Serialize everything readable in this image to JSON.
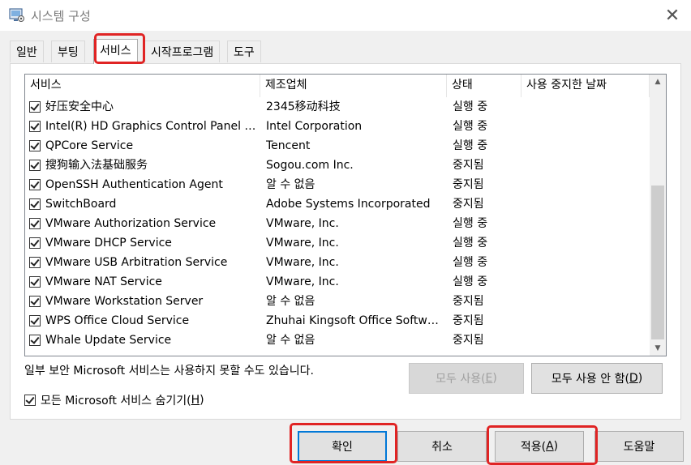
{
  "window": {
    "title": "시스템 구성",
    "icon": "system-config-icon",
    "close_glyph": "✕"
  },
  "tabs": [
    {
      "label": "일반",
      "active": false
    },
    {
      "label": "부팅",
      "active": false
    },
    {
      "label": "서비스",
      "active": true
    },
    {
      "label": "시작프로그램",
      "active": false
    },
    {
      "label": "도구",
      "active": false
    }
  ],
  "services": {
    "columns": [
      "서비스",
      "제조업체",
      "상태",
      "사용 중지한 날짜"
    ],
    "rows": [
      {
        "checked": true,
        "name": "好压安全中心",
        "maker": "2345移动科技",
        "status": "실행 중",
        "disabled_date": ""
      },
      {
        "checked": true,
        "name": "Intel(R) HD Graphics Control Panel S...",
        "maker": "Intel Corporation",
        "status": "실행 중",
        "disabled_date": ""
      },
      {
        "checked": true,
        "name": "QPCore Service",
        "maker": "Tencent",
        "status": "실행 중",
        "disabled_date": ""
      },
      {
        "checked": true,
        "name": "搜狗输入法基础服务",
        "maker": "Sogou.com Inc.",
        "status": "중지됨",
        "disabled_date": ""
      },
      {
        "checked": true,
        "name": "OpenSSH Authentication Agent",
        "maker": "알 수 없음",
        "status": "중지됨",
        "disabled_date": ""
      },
      {
        "checked": true,
        "name": "SwitchBoard",
        "maker": "Adobe Systems Incorporated",
        "status": "중지됨",
        "disabled_date": ""
      },
      {
        "checked": true,
        "name": "VMware Authorization Service",
        "maker": "VMware, Inc.",
        "status": "실행 중",
        "disabled_date": ""
      },
      {
        "checked": true,
        "name": "VMware DHCP Service",
        "maker": "VMware, Inc.",
        "status": "실행 중",
        "disabled_date": ""
      },
      {
        "checked": true,
        "name": "VMware USB Arbitration Service",
        "maker": "VMware, Inc.",
        "status": "실행 중",
        "disabled_date": ""
      },
      {
        "checked": true,
        "name": "VMware NAT Service",
        "maker": "VMware, Inc.",
        "status": "실행 중",
        "disabled_date": ""
      },
      {
        "checked": true,
        "name": "VMware Workstation Server",
        "maker": "알 수 없음",
        "status": "중지됨",
        "disabled_date": ""
      },
      {
        "checked": true,
        "name": "WPS Office Cloud Service",
        "maker": "Zhuhai Kingsoft Office Softwa...",
        "status": "중지됨",
        "disabled_date": ""
      },
      {
        "checked": true,
        "name": "Whale Update Service",
        "maker": "알 수 없음",
        "status": "중지됨",
        "disabled_date": ""
      }
    ]
  },
  "notice": "일부 보안 Microsoft 서비스는 사용하지 못할 수도 있습니다.",
  "enable_all": {
    "label": "모두 사용(",
    "key": "E",
    "suffix": ")",
    "enabled": false
  },
  "disable_all": {
    "label": "모두 사용 안 함(",
    "key": "D",
    "suffix": ")",
    "enabled": true
  },
  "hide_microsoft": {
    "checked": true,
    "label": "모든 Microsoft 서비스 숨기기(",
    "key": "H",
    "suffix": ")"
  },
  "footer": {
    "ok": "확인",
    "cancel": "취소",
    "apply": {
      "label": "적용(",
      "key": "A",
      "suffix": ")"
    },
    "help": "도움말"
  },
  "highlight_color": "#e02424"
}
